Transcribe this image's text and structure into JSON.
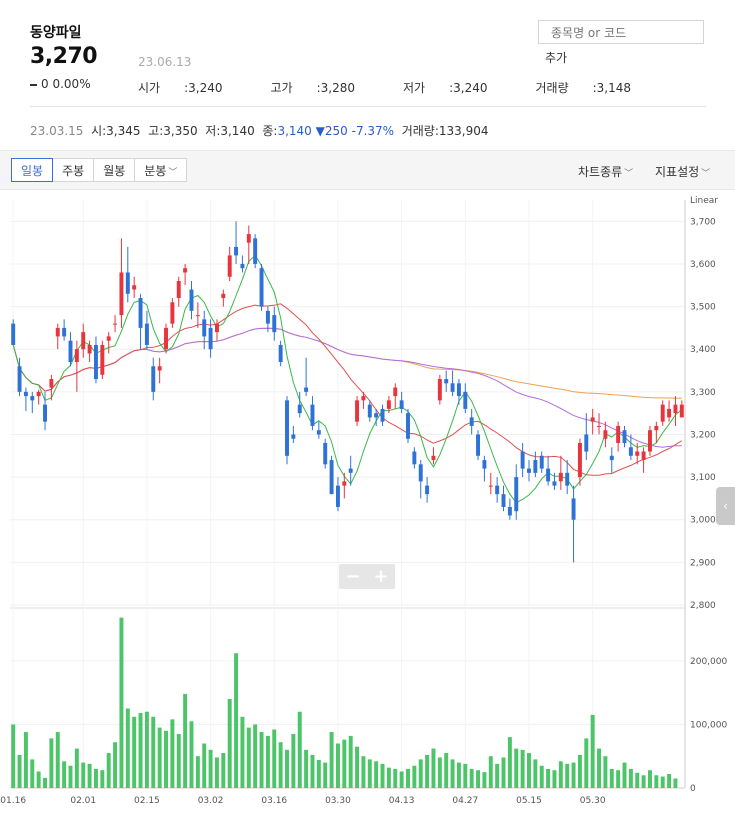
{
  "header": {
    "stock_name": "동양파일",
    "price": "3,270",
    "date": "23.06.13",
    "change": "0",
    "change_pct": "0.00%",
    "open_label": "시가",
    "open": "3,240",
    "high_label": "고가",
    "high": "3,280",
    "low_label": "저가",
    "low": "3,240",
    "volume_label": "거래량",
    "volume": "3,148"
  },
  "search": {
    "placeholder": "종목명 or 코드",
    "add_label": "추가"
  },
  "prev_day": {
    "date": "23.03.15",
    "open_label": "시",
    "open": "3,345",
    "high_label": "고",
    "high": "3,350",
    "low_label": "저",
    "low": "3,140",
    "close_label": "종",
    "close": "3,140",
    "change": "▼250",
    "change_pct": "-7.37%",
    "volume_label": "거래량",
    "volume": "133,904"
  },
  "toolbar": {
    "tabs": [
      "일봉",
      "주봉",
      "월봉",
      "분봉"
    ],
    "active_tab": "일봉",
    "chart_type_label": "차트종류",
    "indicator_label": "지표설정"
  },
  "colors": {
    "up": "#e8343c",
    "down": "#2f72d6",
    "volume": "#4cc468",
    "ma5": "#3bb84a",
    "ma20": "#e0524f",
    "ma60": "#b26ee0",
    "ma120": "#f0a050"
  },
  "chart_data": {
    "type": "candlestick",
    "scale": "Linear",
    "price_axis": {
      "ylim": [
        2800,
        3750
      ],
      "ticks": [
        "2,800",
        "2,900",
        "3,000",
        "3,100",
        "3,200",
        "3,300",
        "3,400",
        "3,500",
        "3,600",
        "3,700"
      ]
    },
    "volume_axis": {
      "ylim": [
        0,
        280000
      ],
      "ticks": [
        "0",
        "100,000",
        "200,000"
      ]
    },
    "x_labels": [
      {
        "label": "01.16",
        "index": 0
      },
      {
        "label": "02.01",
        "index": 11
      },
      {
        "label": "02.15",
        "index": 21
      },
      {
        "label": "03.02",
        "index": 31
      },
      {
        "label": "03.16",
        "index": 41
      },
      {
        "label": "03.30",
        "index": 51
      },
      {
        "label": "04.13",
        "index": 61
      },
      {
        "label": "04.27",
        "index": 71
      },
      {
        "label": "05.15",
        "index": 81
      },
      {
        "label": "05.30",
        "index": 91
      }
    ],
    "candles": [
      [
        3460,
        3470,
        3410,
        3410
      ],
      [
        3360,
        3380,
        3290,
        3300
      ],
      [
        3300,
        3310,
        3255,
        3290
      ],
      [
        3290,
        3300,
        3250,
        3280
      ],
      [
        3290,
        3305,
        3270,
        3300
      ],
      [
        3270,
        3300,
        3210,
        3230
      ],
      [
        3310,
        3340,
        3280,
        3330
      ],
      [
        3430,
        3460,
        3400,
        3450
      ],
      [
        3450,
        3470,
        3420,
        3430
      ],
      [
        3420,
        3440,
        3360,
        3370
      ],
      [
        3370,
        3420,
        3300,
        3400
      ],
      [
        3400,
        3460,
        3380,
        3440
      ],
      [
        3390,
        3420,
        3370,
        3410
      ],
      [
        3410,
        3430,
        3320,
        3330
      ],
      [
        3340,
        3420,
        3330,
        3410
      ],
      [
        3420,
        3440,
        3390,
        3430
      ],
      [
        3460,
        3480,
        3440,
        3460
      ],
      [
        3480,
        3660,
        3450,
        3580
      ],
      [
        3580,
        3640,
        3510,
        3530
      ],
      [
        3540,
        3570,
        3520,
        3550
      ],
      [
        3520,
        3530,
        3400,
        3450
      ],
      [
        3460,
        3490,
        3400,
        3410
      ],
      [
        3360,
        3380,
        3280,
        3300
      ],
      [
        3350,
        3380,
        3320,
        3360
      ],
      [
        3400,
        3460,
        3390,
        3450
      ],
      [
        3460,
        3520,
        3450,
        3510
      ],
      [
        3520,
        3570,
        3500,
        3560
      ],
      [
        3580,
        3600,
        3550,
        3590
      ],
      [
        3540,
        3560,
        3470,
        3490
      ],
      [
        3480,
        3510,
        3450,
        3480
      ],
      [
        3470,
        3490,
        3400,
        3430
      ],
      [
        3450,
        3470,
        3380,
        3400
      ],
      [
        3440,
        3470,
        3420,
        3460
      ],
      [
        3520,
        3540,
        3500,
        3530
      ],
      [
        3570,
        3640,
        3560,
        3620
      ],
      [
        3640,
        3700,
        3600,
        3620
      ],
      [
        3600,
        3620,
        3580,
        3590
      ],
      [
        3650,
        3690,
        3600,
        3670
      ],
      [
        3660,
        3670,
        3590,
        3600
      ],
      [
        3590,
        3600,
        3490,
        3500
      ],
      [
        3490,
        3500,
        3440,
        3460
      ],
      [
        3480,
        3500,
        3420,
        3440
      ],
      [
        3410,
        3420,
        3360,
        3370
      ],
      [
        3280,
        3290,
        3130,
        3150
      ],
      [
        3200,
        3220,
        3180,
        3190
      ],
      [
        3270,
        3300,
        3240,
        3250
      ],
      [
        3310,
        3380,
        3290,
        3300
      ],
      [
        3270,
        3290,
        3210,
        3220
      ],
      [
        3210,
        3230,
        3190,
        3200
      ],
      [
        3180,
        3190,
        3120,
        3130
      ],
      [
        3140,
        3150,
        3060,
        3060
      ],
      [
        3080,
        3100,
        3020,
        3030
      ],
      [
        3080,
        3110,
        3050,
        3090
      ],
      [
        3120,
        3150,
        3080,
        3110
      ],
      [
        3230,
        3290,
        3220,
        3280
      ],
      [
        3280,
        3300,
        3260,
        3290
      ],
      [
        3270,
        3280,
        3230,
        3240
      ],
      [
        3250,
        3260,
        3220,
        3240
      ],
      [
        3260,
        3270,
        3220,
        3230
      ],
      [
        3260,
        3290,
        3250,
        3280
      ],
      [
        3290,
        3320,
        3260,
        3310
      ],
      [
        3280,
        3300,
        3250,
        3260
      ],
      [
        3250,
        3260,
        3180,
        3190
      ],
      [
        3160,
        3170,
        3120,
        3130
      ],
      [
        3130,
        3140,
        3050,
        3090
      ],
      [
        3080,
        3100,
        3040,
        3060
      ],
      [
        3140,
        3170,
        3130,
        3150
      ],
      [
        3280,
        3340,
        3270,
        3330
      ],
      [
        3330,
        3350,
        3300,
        3320
      ],
      [
        3320,
        3350,
        3290,
        3300
      ],
      [
        3320,
        3330,
        3270,
        3290
      ],
      [
        3300,
        3320,
        3250,
        3260
      ],
      [
        3240,
        3260,
        3200,
        3220
      ],
      [
        3200,
        3210,
        3140,
        3150
      ],
      [
        3140,
        3150,
        3090,
        3120
      ],
      [
        3080,
        3110,
        3060,
        3080
      ],
      [
        3080,
        3100,
        3040,
        3060
      ],
      [
        3060,
        3080,
        3020,
        3030
      ],
      [
        3030,
        3050,
        3000,
        3010
      ],
      [
        3100,
        3130,
        3000,
        3020
      ],
      [
        3160,
        3180,
        3100,
        3120
      ],
      [
        3120,
        3140,
        3090,
        3110
      ],
      [
        3140,
        3160,
        3100,
        3110
      ],
      [
        3150,
        3160,
        3110,
        3120
      ],
      [
        3120,
        3150,
        3080,
        3090
      ],
      [
        3090,
        3110,
        3070,
        3080
      ],
      [
        3090,
        3150,
        3070,
        3110
      ],
      [
        3110,
        3140,
        3060,
        3080
      ],
      [
        3050,
        3080,
        2900,
        3000
      ],
      [
        3100,
        3190,
        3080,
        3180
      ],
      [
        3200,
        3250,
        3140,
        3160
      ],
      [
        3230,
        3260,
        3200,
        3240
      ],
      [
        3220,
        3250,
        3200,
        3220
      ],
      [
        3190,
        3230,
        3170,
        3210
      ],
      [
        3150,
        3170,
        3110,
        3140
      ],
      [
        3180,
        3230,
        3160,
        3220
      ],
      [
        3210,
        3220,
        3170,
        3180
      ],
      [
        3170,
        3200,
        3140,
        3150
      ],
      [
        3150,
        3180,
        3130,
        3160
      ],
      [
        3140,
        3170,
        3110,
        3160
      ],
      [
        3160,
        3220,
        3150,
        3210
      ],
      [
        3210,
        3230,
        3180,
        3220
      ],
      [
        3230,
        3280,
        3220,
        3270
      ],
      [
        3240,
        3280,
        3230,
        3260
      ],
      [
        3250,
        3290,
        3220,
        3270
      ],
      [
        3240,
        3280,
        3240,
        3270
      ]
    ],
    "volumes": [
      100000,
      52000,
      88000,
      45000,
      26000,
      16000,
      78000,
      88000,
      42000,
      35000,
      62000,
      40000,
      38000,
      30000,
      28000,
      55000,
      72000,
      268000,
      125000,
      112000,
      118000,
      120000,
      112000,
      95000,
      90000,
      108000,
      85000,
      148000,
      105000,
      50000,
      70000,
      60000,
      48000,
      55000,
      140000,
      212000,
      112000,
      95000,
      100000,
      88000,
      82000,
      92000,
      72000,
      60000,
      85000,
      120000,
      60000,
      52000,
      44000,
      40000,
      88000,
      70000,
      76000,
      82000,
      65000,
      50000,
      45000,
      42000,
      38000,
      32000,
      30000,
      26000,
      30000,
      35000,
      45000,
      52000,
      62000,
      48000,
      55000,
      45000,
      40000,
      38000,
      30000,
      28000,
      25000,
      50000,
      38000,
      48000,
      80000,
      62000,
      60000,
      55000,
      45000,
      35000,
      30000,
      28000,
      42000,
      38000,
      40000,
      52000,
      78000,
      115000,
      62000,
      50000,
      30000,
      28000,
      40000,
      30000,
      24000,
      20000,
      28000,
      20000,
      18000,
      22000,
      15000
    ]
  }
}
